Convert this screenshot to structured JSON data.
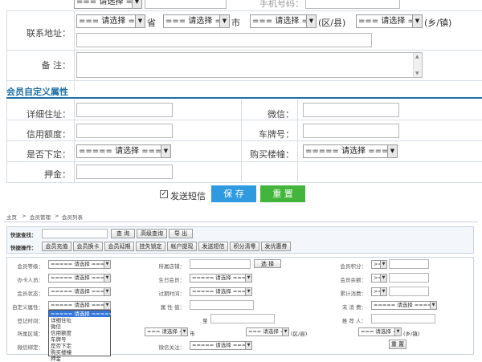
{
  "top": {
    "cut_select_text": "=== 请选择 ===",
    "cut_label": "手机号码：",
    "address_label": "联系地址：",
    "select_placeholder": "=== 请选择 ===",
    "province_unit": "省",
    "city_unit": "市",
    "district_unit": "(区/县)",
    "town_unit": "(乡/镇)",
    "remark_label": "备 注："
  },
  "custom": {
    "title": "会员自定义属性",
    "detail_address_label": "详细住址：",
    "wechat_label": "微信：",
    "credit_label": "信用额度：",
    "plate_label": "车牌号：",
    "is_downline_label": "是否下定：",
    "buy_building_label": "购买楼幢：",
    "select_placeholder": "===== 请选择 =====",
    "deposit_label": "押金：",
    "send_sms_label": "发送短信",
    "save_button": "保 存",
    "reset_button": "重 置"
  },
  "list": {
    "breadcrumb": [
      "主页",
      "会员管理",
      "会员列表"
    ],
    "breadcrumb_sep": ">",
    "quick_search_label": "快速查找：",
    "query_button": "查 询",
    "advanced_query_button": "高级查询",
    "export_button": "导 出",
    "quick_action_label": "快捷操作：",
    "actions": [
      "会员充值",
      "会员换卡",
      "会员延期",
      "挂失锁定",
      "帐户提现",
      "发送短信",
      "积分清零",
      "发优惠券"
    ],
    "filters": {
      "level": "会员等级：",
      "store": "所属店铺：",
      "choose_button": "选 择",
      "points": "会员积分：",
      "agent": "办卡人员：",
      "birthday": "生日会员：",
      "balance": "会员余额：",
      "status": "会员状态：",
      "expire": "过期时间：",
      "total_consume": "累计消费：",
      "custom_attr": "自定义属性：",
      "attr_value": "属 性 值：",
      "no_consume": "未 消 费：",
      "reg_time": "登记时间：",
      "to": "至",
      "referrer": "推 荐 人：",
      "region": "所属区域：",
      "region_city": "市",
      "region_district": "(区/县)",
      "region_town": "(乡/镇)",
      "wechat_bind": "微信绑定：",
      "wechat_follow": "微信关注：",
      "reset_button": "重 置",
      "cmp": ">=",
      "select_text": "===== 请选择 =====",
      "select_text_short": "=== 请选择 ===",
      "dropdown_options": [
        "===== 请选择 =====",
        "详细住址",
        "微信",
        "信用额度",
        "车牌号",
        "是否下定",
        "购买楼幢",
        "押金"
      ]
    }
  },
  "colors": {
    "accent_blue": "#1d6fa5",
    "save_button": "#2f9ae0",
    "reset_button": "#44b53c"
  }
}
